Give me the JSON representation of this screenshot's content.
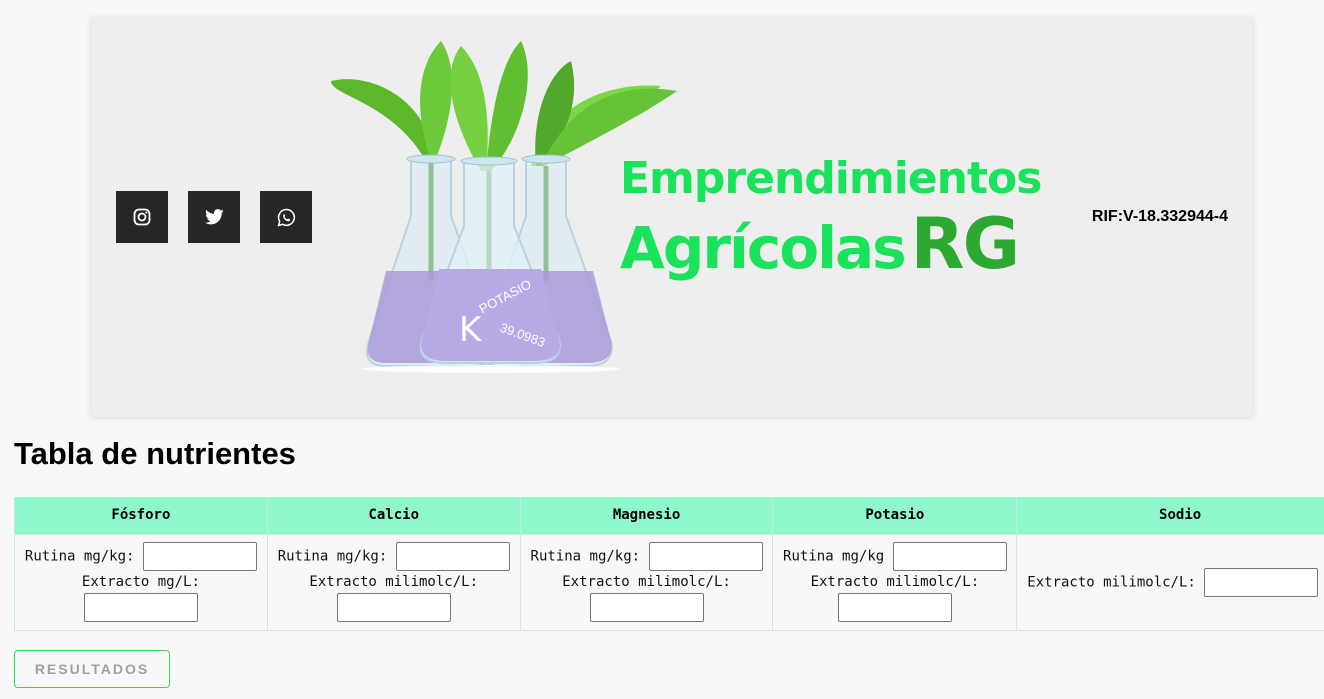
{
  "brand": {
    "line1": "Emprendimientos",
    "line2": "Agrícolas",
    "rg": "RG",
    "rif": "RIF:V-18.332944-4"
  },
  "social": [
    {
      "icon": "instagram-icon"
    },
    {
      "icon": "twitter-icon"
    },
    {
      "icon": "whatsapp-icon"
    }
  ],
  "flasks": [
    {
      "text": "POTASIO",
      "value": "39.0983"
    },
    {
      "text": "K",
      "value": "39.0983"
    }
  ],
  "title": "Tabla de nutrientes",
  "table": {
    "columns": [
      "Fósforo",
      "Calcio",
      "Magnesio",
      "Potasio",
      "Sodio"
    ],
    "fosforo": {
      "label1": "Rutina mg/kg:",
      "label2": "Extracto mg/L:"
    },
    "calcio": {
      "label1": "Rutina mg/kg:",
      "label2": "Extracto milimolc/L:"
    },
    "magnesio": {
      "label1": "Rutina mg/kg:",
      "label2": "Extracto milimolc/L:"
    },
    "potasio": {
      "label1": "Rutina mg/kg",
      "label2": "Extracto milimolc/L:"
    },
    "sodio": {
      "label1": "Extracto milimolc/L:"
    }
  },
  "button": {
    "label": "RESULTADOS"
  },
  "colors": {
    "header_bg": "#8ef7cc",
    "brand_green": "#1ae25a",
    "rg_green": "#2da931",
    "button_border": "#33d64a"
  }
}
